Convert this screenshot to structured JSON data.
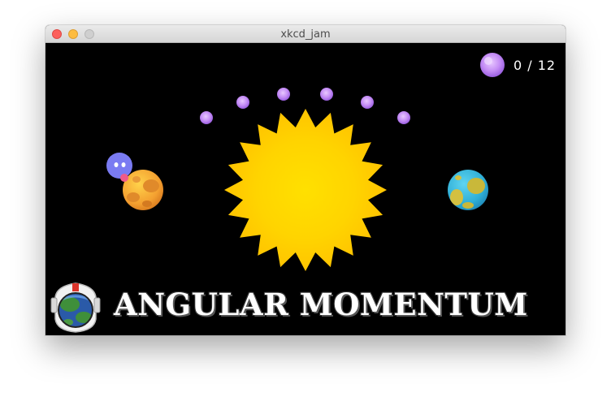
{
  "window": {
    "title": "xkcd_jam"
  },
  "hud": {
    "collected": 0,
    "total": 12,
    "counter_text": "0 / 12",
    "counter_icon": "orb-icon"
  },
  "scene": {
    "sun": "sun",
    "planets": [
      "orange-planet",
      "blue-planet"
    ],
    "player": "blue-blob-character",
    "orbs_visible": 6
  },
  "title_banner": {
    "text": "ANGULAR MOMENTUM",
    "logo": "astronaut-helmet-earth-icon"
  },
  "colors": {
    "background": "#000000",
    "sun": "#ffd000",
    "orb": "#c48cf5",
    "player": "#7a7bf2",
    "planet_orange": "#f0a030",
    "planet_blue": "#36b6d8"
  }
}
